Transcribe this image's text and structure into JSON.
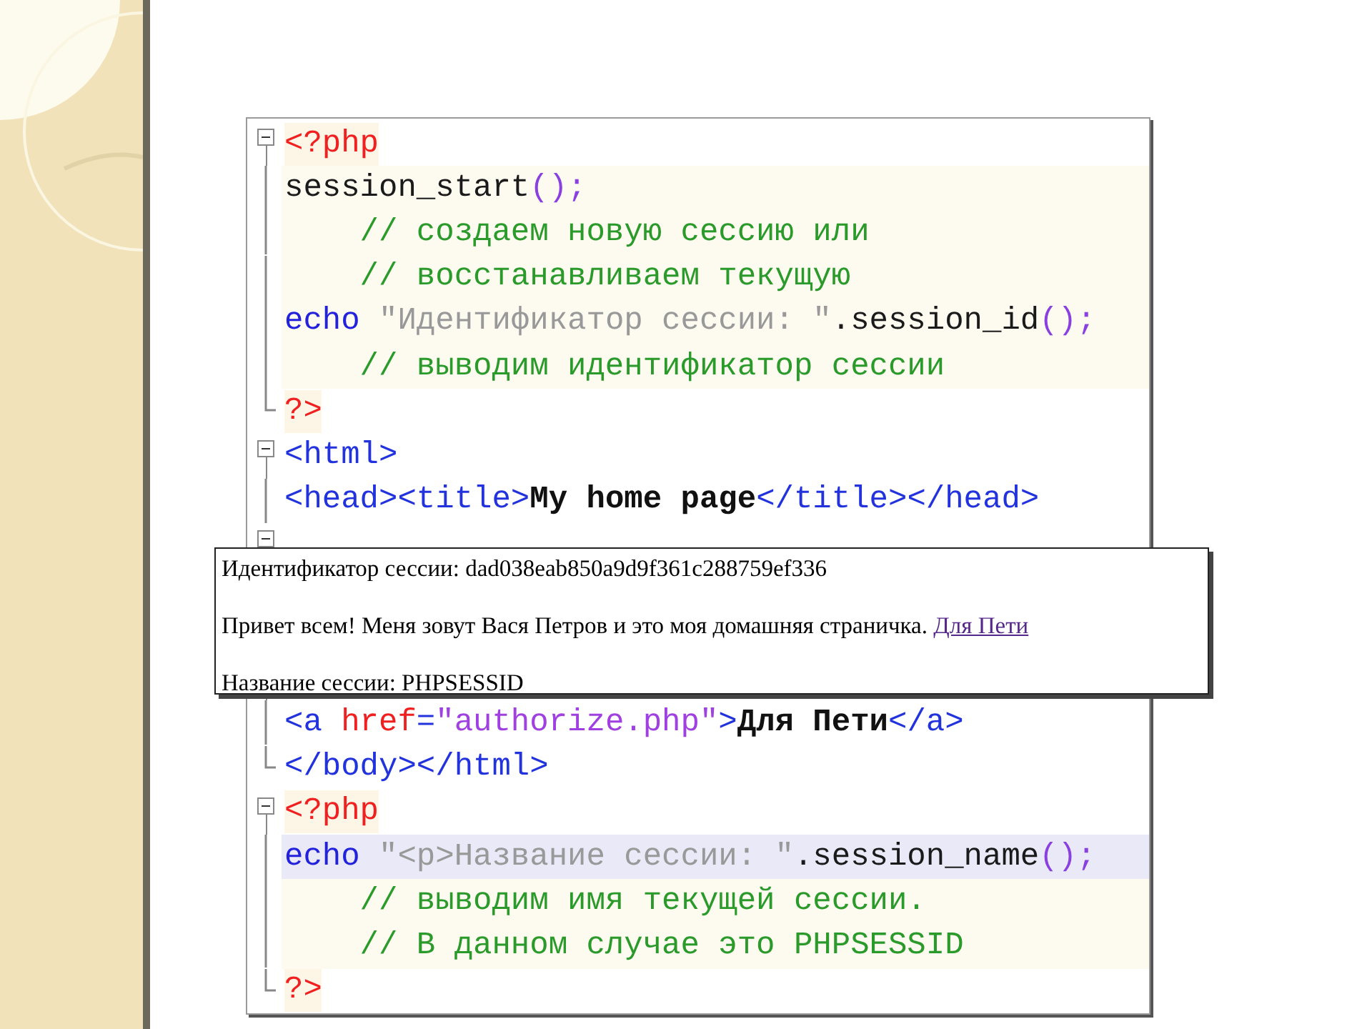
{
  "editor": {
    "top_lines": [
      {
        "gutter": {
          "kind": "open"
        },
        "shade": {
          "kind": "tag"
        },
        "spans": [
          {
            "text": "<?php",
            "kind": "php"
          }
        ]
      },
      {
        "gutter": {
          "kind": "line"
        },
        "shade": {
          "kind": "block"
        },
        "spans": [
          {
            "text": "session_start",
            "kind": "func"
          },
          {
            "text": "();",
            "kind": "paren"
          }
        ]
      },
      {
        "gutter": {
          "kind": "line"
        },
        "shade": {
          "kind": "block"
        },
        "spans": [
          {
            "text": "    // создаем новую сессию или",
            "kind": "comment"
          }
        ]
      },
      {
        "gutter": {
          "kind": "line"
        },
        "shade": {
          "kind": "block"
        },
        "spans": [
          {
            "text": "    // восстанавливаем текущую",
            "kind": "comment"
          }
        ]
      },
      {
        "gutter": {
          "kind": "line"
        },
        "shade": {
          "kind": "block"
        },
        "spans": [
          {
            "text": "echo",
            "kind": "keyword"
          },
          {
            "text": " \"Идентификатор сессии: \"",
            "kind": "string"
          },
          {
            "text": ".session_id",
            "kind": "func"
          },
          {
            "text": "();",
            "kind": "paren"
          }
        ]
      },
      {
        "gutter": {
          "kind": "line"
        },
        "shade": {
          "kind": "block"
        },
        "spans": [
          {
            "text": "    // выводим идентификатор сессии",
            "kind": "comment"
          }
        ]
      },
      {
        "gutter": {
          "kind": "end"
        },
        "shade": {
          "kind": "tag"
        },
        "spans": [
          {
            "text": "?>",
            "kind": "php"
          }
        ]
      },
      {
        "gutter": {
          "kind": "open"
        },
        "spans": [
          {
            "text": "<html>",
            "kind": "tag"
          }
        ]
      },
      {
        "gutter": {
          "kind": "line"
        },
        "spans": [
          {
            "text": "<head><title>",
            "kind": "tag"
          },
          {
            "text": "My home page",
            "kind": "text"
          },
          {
            "text": "</title></head>",
            "kind": "tag"
          }
        ]
      },
      {
        "gutter": {
          "kind": "open"
        }
      }
    ],
    "bottom_lines": [
      {
        "gutter": {
          "kind": "line"
        },
        "spans": [
          {
            "text": "<a ",
            "kind": "tag"
          },
          {
            "text": "href",
            "kind": "attr"
          },
          {
            "text": "=",
            "kind": "tag"
          },
          {
            "text": "\"authorize.php\"",
            "kind": "value"
          },
          {
            "text": ">",
            "kind": "tag"
          },
          {
            "text": "Для Пети",
            "kind": "text"
          },
          {
            "text": "</a>",
            "kind": "tag"
          }
        ]
      },
      {
        "gutter": {
          "kind": "end"
        },
        "spans": [
          {
            "text": "</body></html>",
            "kind": "tag"
          }
        ]
      },
      {
        "gutter": {
          "kind": "open"
        },
        "shade": {
          "kind": "tag"
        },
        "spans": [
          {
            "text": "<?php",
            "kind": "php"
          }
        ]
      },
      {
        "gutter": {
          "kind": "line"
        },
        "shade": {
          "kind": "current"
        },
        "spans": [
          {
            "text": "echo",
            "kind": "keyword"
          },
          {
            "text": " \"<p>Название сессии: \"",
            "kind": "string"
          },
          {
            "text": ".session_name",
            "kind": "func"
          },
          {
            "text": "();",
            "kind": "paren"
          }
        ]
      },
      {
        "gutter": {
          "kind": "line"
        },
        "shade": {
          "kind": "block"
        },
        "spans": [
          {
            "text": "    // выводим имя текущей сессии.",
            "kind": "comment"
          }
        ]
      },
      {
        "gutter": {
          "kind": "line"
        },
        "shade": {
          "kind": "block"
        },
        "spans": [
          {
            "text": "    // В данном случае это PHPSESSID",
            "kind": "comment"
          }
        ]
      },
      {
        "gutter": {
          "kind": "end"
        },
        "shade": {
          "kind": "tag"
        },
        "spans": [
          {
            "text": "?>",
            "kind": "php"
          }
        ]
      }
    ]
  },
  "browser_output": {
    "lines": [
      {
        "text": "Идентификатор сессии: dad038eab850a9d9f361c288759ef336"
      },
      {
        "text": "Привет всем! Меня зовут Вася Петров и это моя домашняя страничка.",
        "link": "Для Пети"
      },
      {
        "text": "Название сессии: PHPSESSID"
      }
    ]
  }
}
